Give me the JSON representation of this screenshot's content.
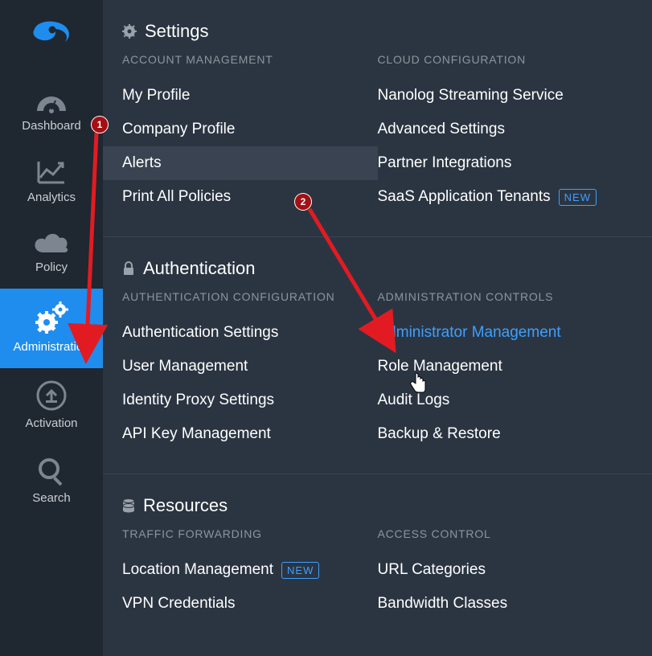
{
  "sidebar": {
    "items": [
      {
        "label": "Dashboard",
        "icon": "gauge"
      },
      {
        "label": "Analytics",
        "icon": "analytics"
      },
      {
        "label": "Policy",
        "icon": "cloud"
      },
      {
        "label": "Administration",
        "icon": "gears",
        "active": true
      },
      {
        "label": "Activation",
        "icon": "activation"
      },
      {
        "label": "Search",
        "icon": "search"
      }
    ]
  },
  "sections": {
    "settings": {
      "title": "Settings",
      "left_title": "ACCOUNT MANAGEMENT",
      "right_title": "CLOUD CONFIGURATION",
      "left_items": {
        "my_profile": "My Profile",
        "company_profile": "Company Profile",
        "alerts": "Alerts",
        "print_all_policies": "Print All Policies"
      },
      "right_items": {
        "nss": "Nanolog Streaming Service",
        "advanced": "Advanced Settings",
        "partner": "Partner Integrations",
        "saas": "SaaS Application Tenants",
        "new_badge": "NEW"
      }
    },
    "authentication": {
      "title": "Authentication",
      "left_title": "AUTHENTICATION CONFIGURATION",
      "right_title": "ADMINISTRATION CONTROLS",
      "left_items": {
        "auth_settings": "Authentication Settings",
        "user_mgmt": "User Management",
        "identity_proxy": "Identity Proxy Settings",
        "api_key": "API Key Management"
      },
      "right_items": {
        "admin_mgmt": "Administrator Management",
        "role_mgmt": "Role Management",
        "audit_logs": "Audit Logs",
        "backup_restore": "Backup & Restore"
      }
    },
    "resources": {
      "title": "Resources",
      "left_title": "TRAFFIC FORWARDING",
      "right_title": "ACCESS CONTROL",
      "left_items": {
        "location": "Location Management",
        "vpn": "VPN Credentials",
        "new_badge": "NEW"
      },
      "right_items": {
        "url_cat": "URL Categories",
        "bandwidth": "Bandwidth Classes"
      }
    }
  },
  "annotations": {
    "badge1": "1",
    "badge2": "2"
  }
}
